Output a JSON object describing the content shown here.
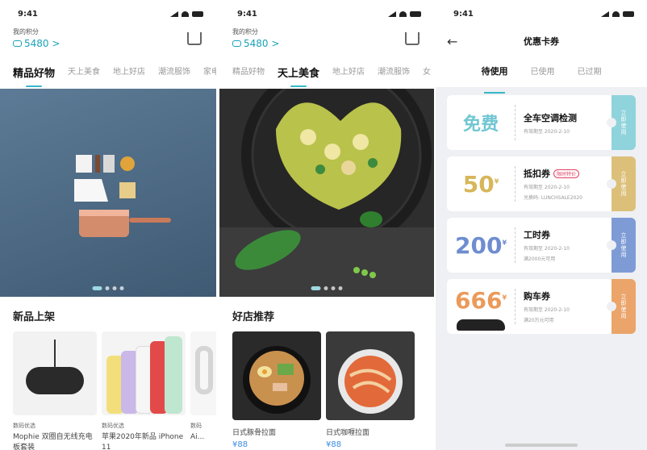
{
  "status": {
    "time": "9:41"
  },
  "screen1": {
    "points_label": "我的积分",
    "points_value": "5480 >",
    "tabs": [
      "精品好物",
      "天上美食",
      "地上好店",
      "潮流服饰",
      "家电"
    ],
    "active_tab": 0,
    "section_title": "新品上架",
    "products": [
      {
        "category": "数码优选",
        "name": "Mophie 双圈自无线充电板套装",
        "price": ""
      },
      {
        "category": "数码优选",
        "name": "苹果2020年新品 iPhone 11",
        "price": ""
      },
      {
        "category": "数码",
        "name": "Ai...",
        "price": ""
      }
    ]
  },
  "screen2": {
    "points_label": "我的积分",
    "points_value": "5480 >",
    "tabs": [
      "精品好物",
      "天上美食",
      "地上好店",
      "潮流服饰",
      "女"
    ],
    "active_tab": 1,
    "section_title": "好店推荐",
    "cards": [
      {
        "name": "日式豚骨拉面",
        "price": "¥88"
      },
      {
        "name": "日式咖喱拉面",
        "price": "¥88"
      }
    ]
  },
  "screen3": {
    "title": "优惠卡券",
    "tabs": [
      "待使用",
      "已使用",
      "已过期"
    ],
    "active_tab": 0,
    "coupons": [
      {
        "value": "免费",
        "unit": "",
        "name": "全车空调检测",
        "tag": "",
        "lines": [
          "有效期至 2020-2-10"
        ],
        "side_label": "立即使用",
        "color": "#8fd3dc",
        "value_color": "#6fc6d2"
      },
      {
        "value": "50",
        "unit": "¥",
        "name": "抵扣券",
        "tag": "限时特价",
        "lines": [
          "有效期至 2020-2-10",
          "兑换码: LUNCHSALE2020"
        ],
        "side_label": "立即使用",
        "color": "#dcc07a",
        "value_color": "#d7b65a"
      },
      {
        "value": "200",
        "unit": "¥",
        "name": "工时券",
        "tag": "",
        "lines": [
          "有效期至 2020-2-10",
          "满2000元可用"
        ],
        "side_label": "立即使用",
        "color": "#7e9bd6",
        "value_color": "#6f8dcf"
      },
      {
        "value": "666",
        "unit": "¥",
        "name": "购车券",
        "tag": "",
        "lines": [
          "有效期至 2020-2-10",
          "满20万元可用"
        ],
        "side_label": "立即使用",
        "color": "#eba46a",
        "value_color": "#ea9a5a"
      }
    ]
  }
}
